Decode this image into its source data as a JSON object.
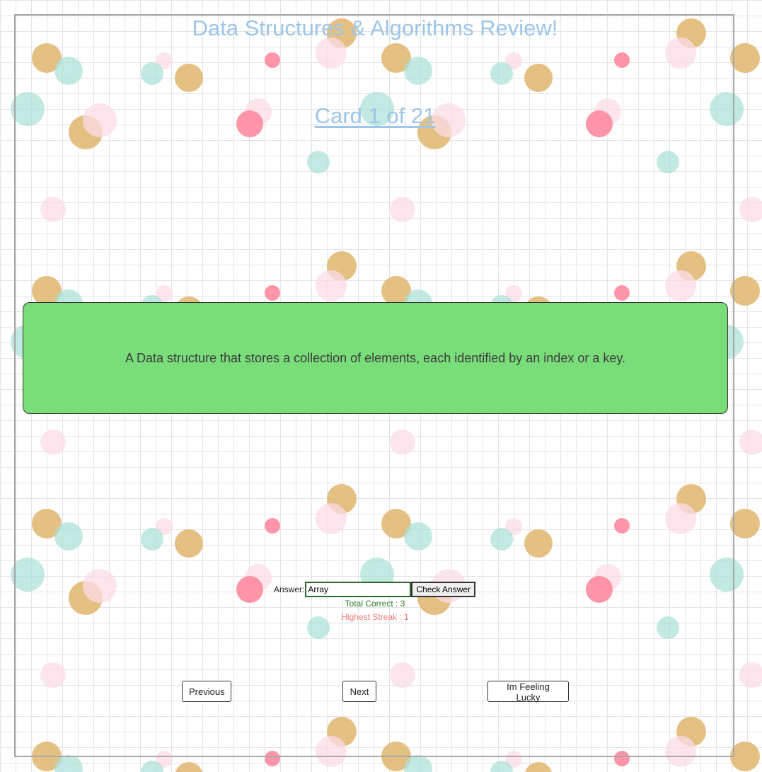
{
  "header": {
    "title": "Data Structures & Algorithms Review!",
    "card_counter": "Card 1 of 21"
  },
  "card": {
    "text": "A Data structure that stores a collection of elements, each identified by an index or a key.",
    "color": "#79dd79"
  },
  "answer": {
    "label": "Answer:",
    "value": "Array",
    "check_label": "Check Answer"
  },
  "stats": {
    "total_correct": "Total Correct : 3",
    "highest_streak": "Highest Streak : 1"
  },
  "nav": {
    "previous_label": "Previous",
    "next_label": "Next",
    "lucky_label": "Im Feeling Lucky"
  },
  "colors": {
    "title": "#9dc5e8",
    "correct": "#2e7d32",
    "streak": "#f07a7a",
    "gold": "#e3bd7c",
    "pink": "#fbdce5",
    "coral": "#ff8fa3",
    "mint": "#a8e0d6"
  }
}
